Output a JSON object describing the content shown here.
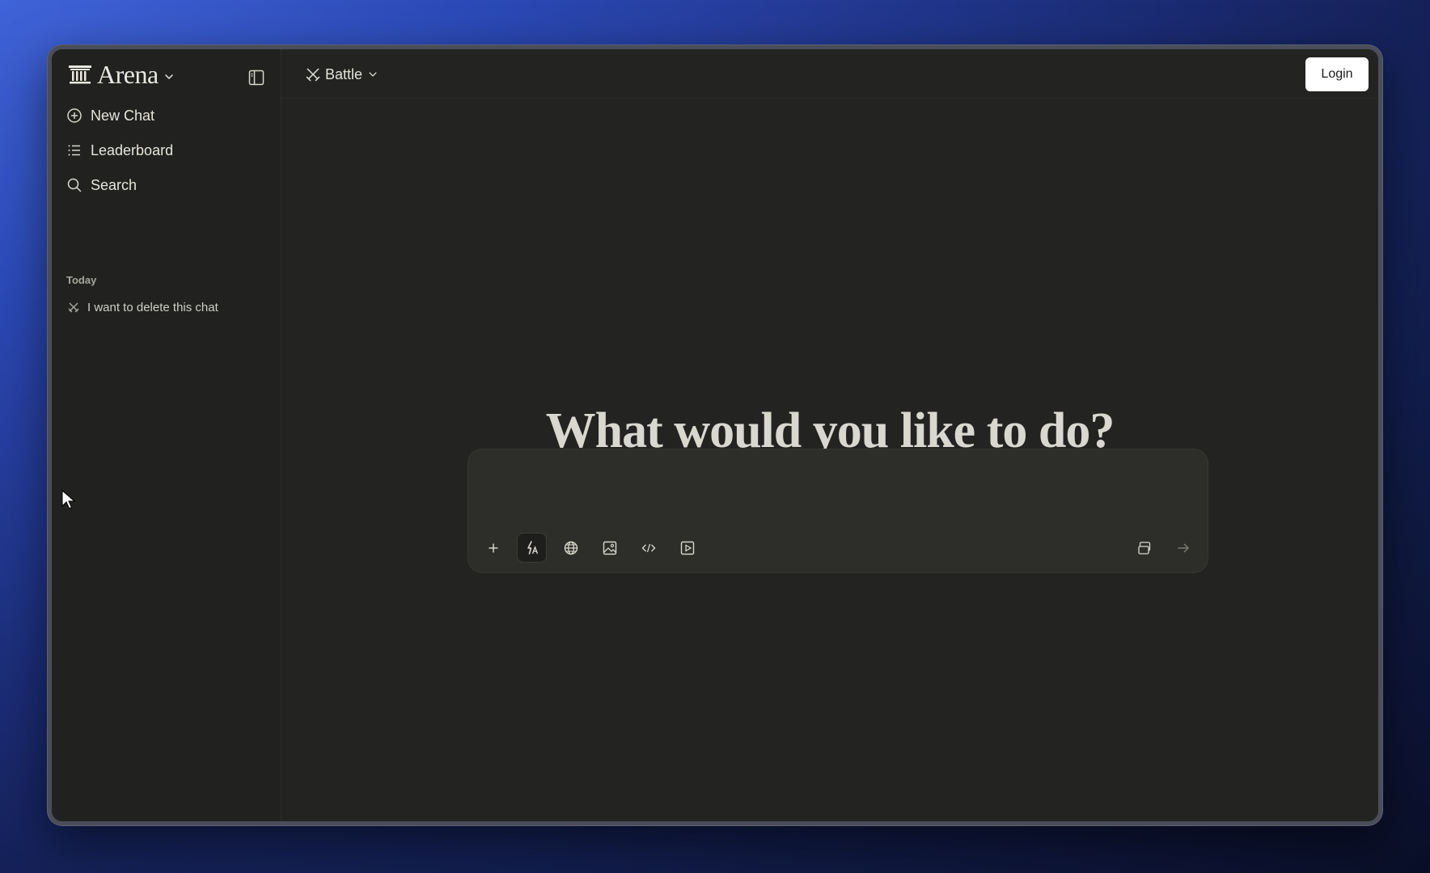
{
  "app": {
    "brand_name": "Arena"
  },
  "sidebar": {
    "nav": [
      {
        "label": "New Chat",
        "icon": "plus-circle-icon"
      },
      {
        "label": "Leaderboard",
        "icon": "list-icon"
      },
      {
        "label": "Search",
        "icon": "search-icon"
      }
    ],
    "section_label": "Today",
    "history": [
      {
        "label": "I want to delete this chat",
        "icon": "swords-icon"
      }
    ]
  },
  "topbar": {
    "mode_label": "Battle",
    "login_label": "Login"
  },
  "main": {
    "headline": "What would you like to do?",
    "input_value": "",
    "input_placeholder": ""
  },
  "colors": {
    "background_accent": "#2b48b4",
    "panel": "#232321",
    "composer": "#2d2d2a",
    "text": "#e6e5de"
  }
}
